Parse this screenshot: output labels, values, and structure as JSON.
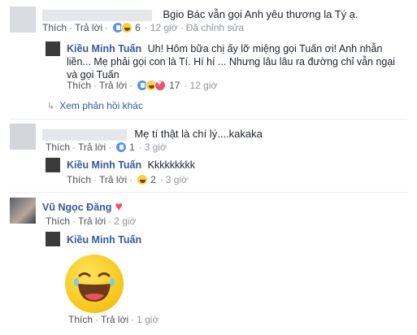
{
  "comments": [
    {
      "text": "Bgio Bác vẫn gọi Anh yêu thương la Tý ạ.",
      "like": "Thích",
      "reply": "Trả lời",
      "reactions": "6",
      "time": "12 giờ",
      "edited": "Đã chỉnh sửa",
      "reply_item": {
        "name": "Kiều Minh Tuấn",
        "text": "Uh! Hôm bữa chị ấy lỡ miệng gọi Tuấn ơi! Anh nhẫn liền... Mẹ phải gọi con là Tí. Hí hí ... Nhưng lâu lâu ra đường chỉ vẫn ngại và gọi Tuấn",
        "like": "Thích",
        "reply": "Trả lời",
        "reactions": "17",
        "time": "12 giờ"
      },
      "more_replies": "Xem phản hồi khác"
    },
    {
      "text": "Mẹ tí thật là chí lý....kakaka",
      "like": "Thích",
      "reply": "Trả lời",
      "reactions": "1",
      "time": "3 giờ",
      "reply_item": {
        "name": "Kiều Minh Tuấn",
        "text": "Kkkkkkkkk",
        "like": "Thích",
        "reply": "Trả lời",
        "reactions": "2",
        "time": "3 giờ"
      }
    },
    {
      "name": "Vũ Ngọc Đăng",
      "like": "Thích",
      "reply": "Trả lời",
      "time": "2 giờ",
      "reply_item": {
        "name": "Kiều Minh Tuấn",
        "like": "Thích",
        "reply": "Trả lời",
        "time": "1 giờ"
      }
    }
  ],
  "icons": {
    "love": "heart-icon",
    "expand": "reply-arrow-icon",
    "sticker": "laughing-face-emoji"
  },
  "colors": {
    "link": "#365899",
    "love": "#f25268",
    "like": "#5890ff"
  }
}
